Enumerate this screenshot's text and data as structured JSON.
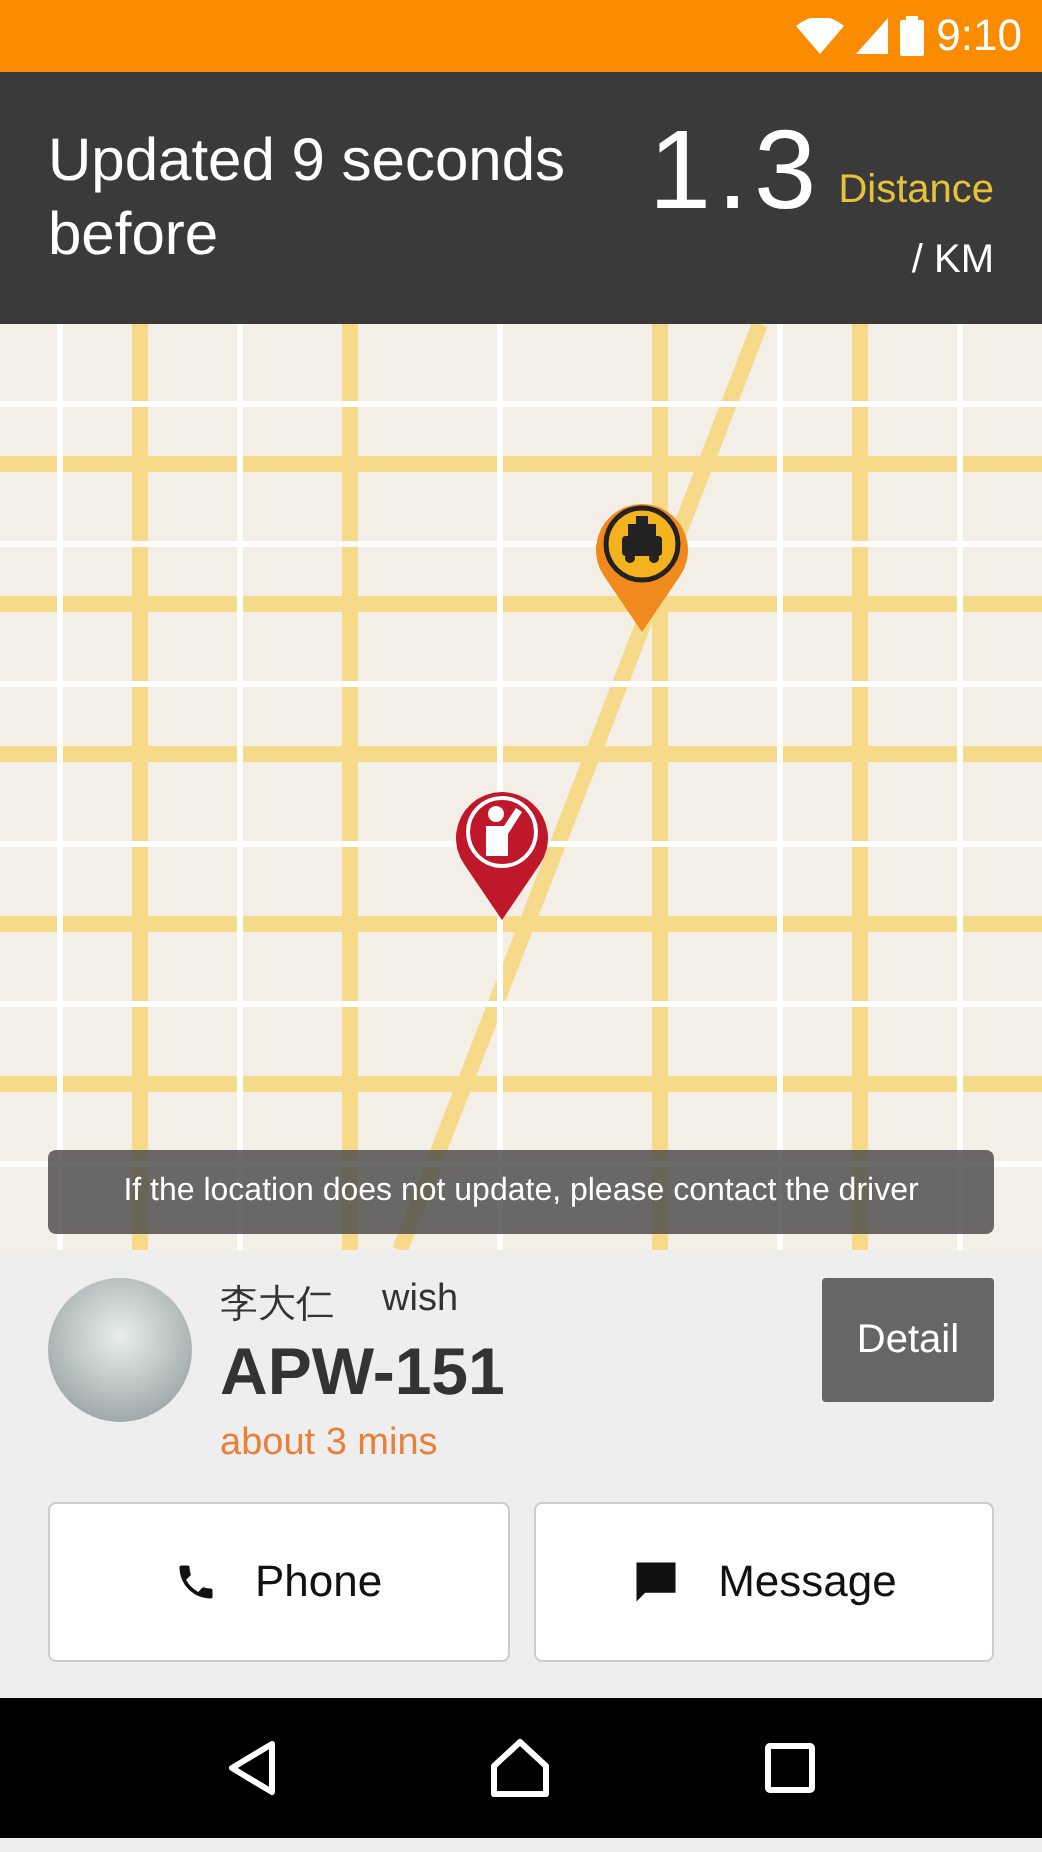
{
  "status_bar": {
    "time": "9:10"
  },
  "header": {
    "updated": "Updated 9 seconds before",
    "distance": "1.3",
    "distance_label": "Distance",
    "unit": "/ KM"
  },
  "map": {
    "notice": "If the location does not update, please contact the driver"
  },
  "driver": {
    "name": "李大仁",
    "note": "wish",
    "plate": "APW-151",
    "eta": "about 3 mins",
    "detail_button": "Detail"
  },
  "actions": [
    {
      "kind": "phone",
      "label": "Phone"
    },
    {
      "kind": "message",
      "label": "Message"
    }
  ]
}
